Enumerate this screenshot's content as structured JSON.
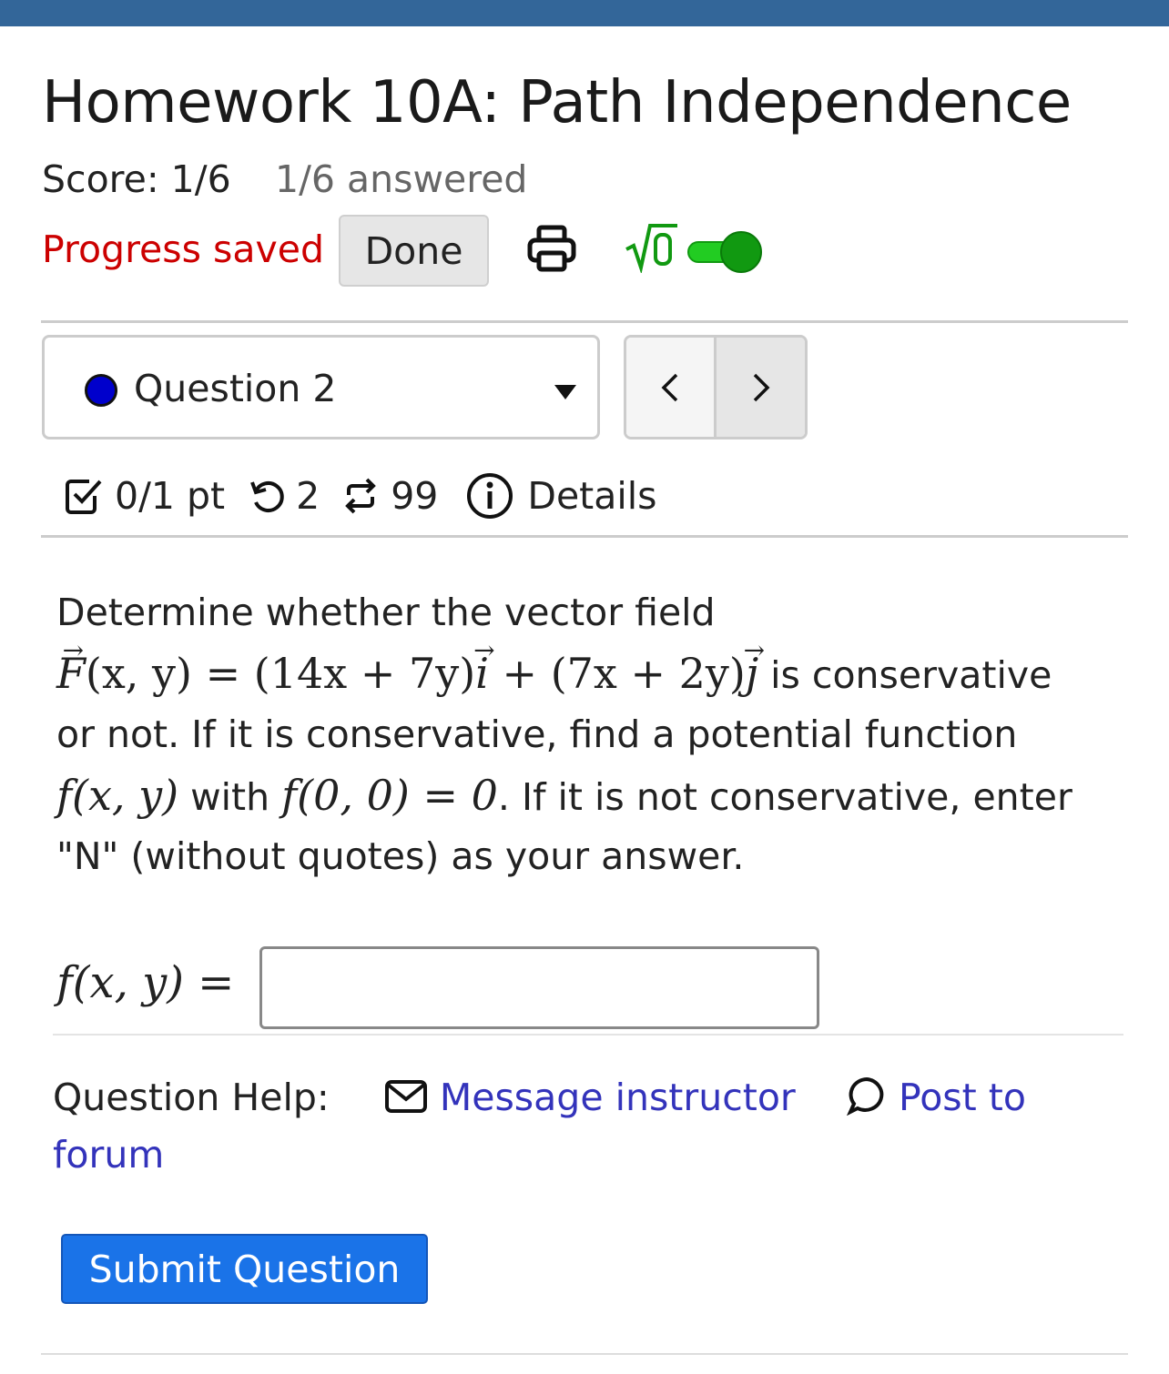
{
  "header": {
    "title": "Homework 10A: Path Independence",
    "score": "Score: 1/6",
    "answered": "1/6 answered",
    "progress": "Progress saved",
    "done_label": "Done",
    "math_toggle_on": true
  },
  "question_nav": {
    "selected": "Question 2",
    "status_color": "#0000cc",
    "prev_glyph": "<",
    "next_glyph": ">"
  },
  "meta": {
    "points": "0/1 pt",
    "attempts": "2",
    "tries": "99",
    "details": "Details"
  },
  "question": {
    "line1": "Determine whether the vector field",
    "line2_suffix": " is conservative",
    "line3": "or not. If it is conservative, find a potential function",
    "line4_with": " with ",
    "line4_suffix": ". If it is not conservative, enter",
    "line5": "\"N\" (without quotes) as your answer.",
    "math": {
      "F_lhs": "F",
      "F_args": "(x, y) = (14x + 7y)",
      "i": "i",
      "plus": " + (7x + 2y)",
      "j": "j",
      "fxy": "f(x, y)",
      "f00": "f(0, 0) = 0"
    }
  },
  "answer": {
    "label": "f(x, y) =",
    "value": ""
  },
  "help": {
    "label": "Question Help:",
    "message": "Message instructor",
    "post_a": "Post to",
    "post_b": "forum"
  },
  "submit_label": "Submit Question",
  "colors": {
    "topbar": "#336699",
    "progress": "#cc0000",
    "link": "#3333bb",
    "submit": "#1a73e8",
    "toggle_on": "#22aa22"
  }
}
